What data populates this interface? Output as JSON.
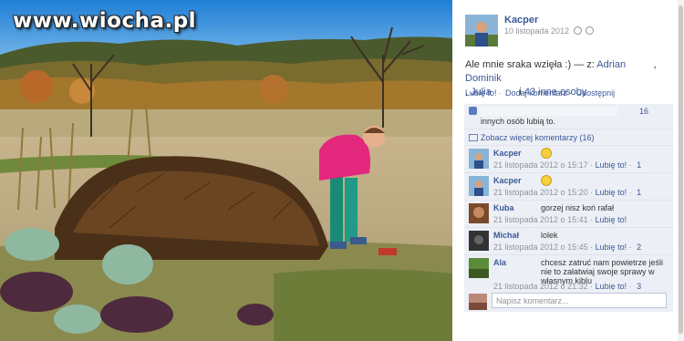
{
  "watermark": "www.wiocha.pl",
  "post": {
    "author": "Kacper",
    "date": "10 listopada 2012",
    "text_main": "Ale mnie sraka wzięła :) — z: ",
    "tagged_1": "Adrian",
    "tagged_2": "Dominik",
    "tagged_3": "Julia",
    "tagged_and": " i ",
    "others": "43 inne osoby",
    "actions": {
      "like": "Lubię to!",
      "comment": "Dodaj komentarz",
      "share": "Udostępnij"
    }
  },
  "ufi": {
    "likes_count": "16",
    "likes_text": "innych osób lubią to.",
    "more_comments": "Zobacz więcej komentarzy (16)",
    "comments": [
      {
        "name": "Kacper",
        "text": "",
        "emoji": "smiley",
        "time": "21 listopada 2012 o 15:17",
        "like_label": "Lubię to!",
        "likes": "1"
      },
      {
        "name": "Kacper",
        "text": "",
        "emoji": "smiley",
        "time": "21 listopada 2012 o 15:20",
        "like_label": "Lubię to!",
        "likes": "1"
      },
      {
        "name": "Kuba",
        "text": "gorzej nisz koń rafał",
        "time": "21 listopada 2012 o 15:41",
        "like_label": "Lubię to!",
        "likes": ""
      },
      {
        "name": "Michał",
        "text": "lolek",
        "time": "21 listopada 2012 o 15:45",
        "like_label": "Lubię to!",
        "likes": "2"
      },
      {
        "name": "Ala",
        "text": "chcesz zatruć nam powietrze jeśli nie to załatwiaj swoje sprawy w własnym kiblu",
        "time": "21 listopada 2012 o 21:32",
        "like_label": "Lubię to!",
        "likes": "3"
      }
    ],
    "write_placeholder": "Napisz komentarz..."
  },
  "colors": {
    "link": "#3b5998",
    "ufi_bg": "#eceff5",
    "meta": "#90949c"
  },
  "icons": [
    "globe-icon",
    "thumbs-up-icon",
    "comment-icon",
    "smiley-icon"
  ]
}
